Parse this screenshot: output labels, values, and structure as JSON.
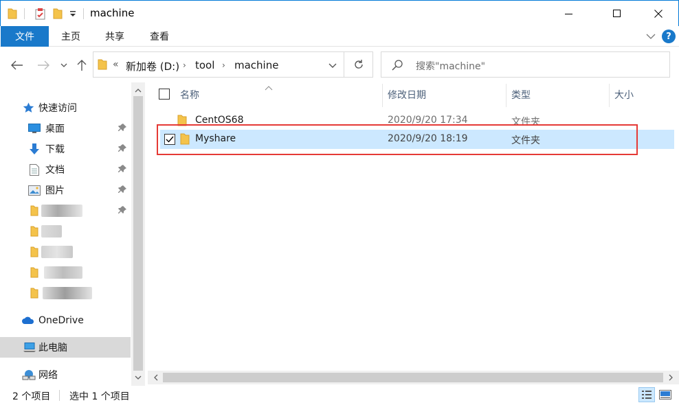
{
  "window": {
    "title": "machine",
    "minimize_glyph": "—",
    "maximize_glyph": "☐",
    "close_glyph": "✕"
  },
  "ribbon": {
    "tabs": [
      "文件",
      "主页",
      "共享",
      "查看"
    ],
    "help_glyph": "?",
    "accent_color": "#1979ca"
  },
  "address": {
    "overflow": "«",
    "breadcrumbs": [
      "新加卷 (D:)",
      "tool",
      "machine"
    ],
    "separator": "›"
  },
  "search": {
    "placeholder": "搜索\"machine\""
  },
  "nav_pane": {
    "quick_access": "快速访问",
    "items": [
      {
        "label": "桌面",
        "icon": "desktop-icon",
        "pinned": true
      },
      {
        "label": "下载",
        "icon": "download-icon",
        "pinned": true
      },
      {
        "label": "文档",
        "icon": "documents-icon",
        "pinned": true
      },
      {
        "label": "图片",
        "icon": "pictures-icon",
        "pinned": true
      }
    ],
    "onedrive": "OneDrive",
    "this_pc": "此电脑",
    "network": "网络"
  },
  "columns": {
    "name": "名称",
    "modified": "修改日期",
    "type": "类型",
    "size": "大小"
  },
  "files": [
    {
      "name": "CentOS68",
      "modified": "2020/9/20 17:34",
      "type": "文件夹",
      "selected": false
    },
    {
      "name": "Myshare",
      "modified": "2020/9/20 18:19",
      "type": "文件夹",
      "selected": true
    }
  ],
  "status": {
    "item_count": "2 个项目",
    "selected_count": "选中 1 个项目"
  },
  "colors": {
    "selection": "#cce8ff",
    "highlight_border": "#e53935",
    "folder": "#f4c34b"
  }
}
